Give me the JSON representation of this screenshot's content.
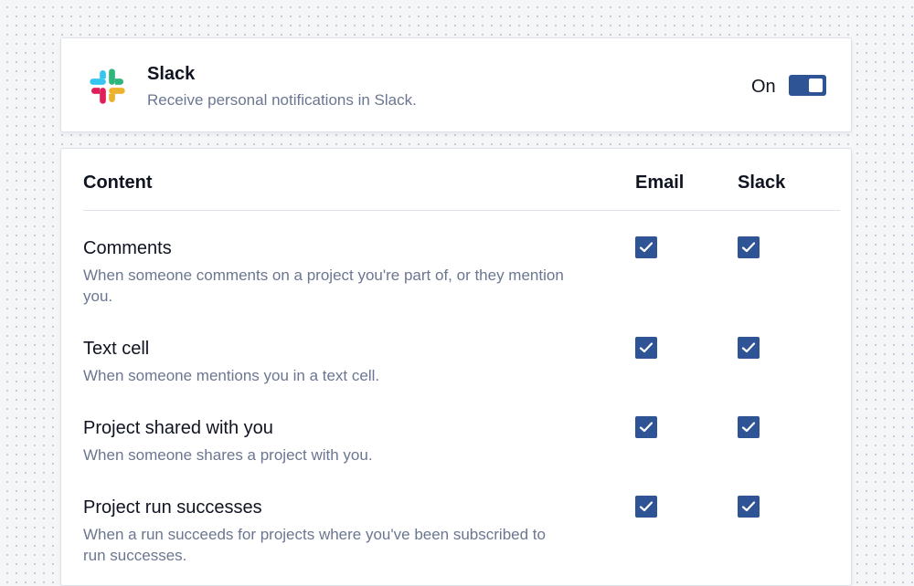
{
  "integration": {
    "name": "Slack",
    "description": "Receive personal notifications in Slack.",
    "toggle_label": "On",
    "toggle_state": true,
    "icon": "slack-logo-icon"
  },
  "table": {
    "columns": [
      "Content",
      "Email",
      "Slack"
    ],
    "rows": [
      {
        "title": "Comments",
        "description": "When someone comments on a project you're part of, or they mention you.",
        "email": true,
        "slack": true
      },
      {
        "title": "Text cell",
        "description": "When someone mentions you in a text cell.",
        "email": true,
        "slack": true
      },
      {
        "title": "Project shared with you",
        "description": "When someone shares a project with you.",
        "email": true,
        "slack": true
      },
      {
        "title": "Project run successes",
        "description": "When a run succeeds for projects where you've been subscribed to run successes.",
        "email": true,
        "slack": true
      }
    ]
  },
  "colors": {
    "accent": "#2f5496",
    "muted_text": "#6b7690",
    "slack_blue": "#36c5f0",
    "slack_green": "#2eb67d",
    "slack_red": "#e01e5a",
    "slack_yellow": "#ecb22e"
  }
}
